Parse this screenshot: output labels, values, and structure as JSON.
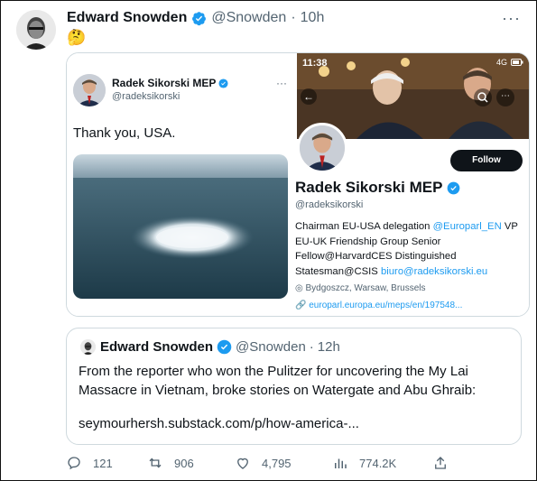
{
  "tweet": {
    "author_name": "Edward Snowden",
    "handle": "@Snowden",
    "separator": "·",
    "time": "10h",
    "more_label": "···",
    "text": "🤔"
  },
  "left_card": {
    "name": "Radek Sikorski MEP",
    "handle": "@radeksikorski",
    "more_label": "···",
    "text": "Thank you, USA."
  },
  "right_card": {
    "status_time": "11:38",
    "network": "4G",
    "follow_label": "Follow",
    "name": "Radek Sikorski MEP",
    "handle": "@radeksikorski",
    "bio_line1_prefix": "Chairman EU-USA delegation ",
    "bio_line1_link": "@Europarl_EN",
    "bio_line1_suffix": " VP",
    "bio_line2": "EU-UK Friendship Group Senior",
    "bio_line3": "Fellow@HarvardCES Distinguished",
    "bio_line4_prefix": "Statesman@CSIS ",
    "bio_line4_link": "biuro@radeksikorski.eu",
    "location": "Bydgoszcz, Warsaw, Brussels",
    "url": "europarl.europa.eu/meps/en/197548..."
  },
  "quote": {
    "author_name": "Edward Snowden",
    "handle": "@Snowden",
    "separator": "·",
    "time": "12h",
    "text": "From the reporter who won the Pulitzer for uncovering the My Lai Massacre in Vietnam, broke stories on Watergate and Abu Ghraib:",
    "link": "seymourhersh.substack.com/p/how-america-..."
  },
  "actions": {
    "replies": "121",
    "retweets": "906",
    "likes": "4,795",
    "views": "774.2K"
  },
  "colors": {
    "accent": "#1d9bf0",
    "text": "#0f1419",
    "muted": "#536471",
    "border": "#cfd9de"
  }
}
